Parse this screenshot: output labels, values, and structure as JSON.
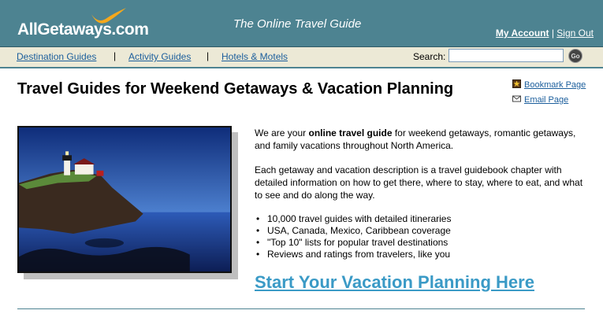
{
  "header": {
    "logo": "AllGetaways.com",
    "tagline": "The Online Travel Guide",
    "my_account": "My Account",
    "separator": "|",
    "sign_out": "Sign Out",
    "bg_color": "#4d8391"
  },
  "nav": {
    "items": [
      "Destination Guides",
      "Activity Guides",
      "Hotels & Motels"
    ],
    "separator": "|",
    "search_label": "Search:",
    "search_value": "",
    "go_label": "Go"
  },
  "main": {
    "title": "Travel Guides for Weekend Getaways & Vacation Planning",
    "side_links": {
      "bookmark": "Bookmark Page",
      "email": "Email Page"
    },
    "intro_before": "We are your ",
    "intro_bold": "online travel guide",
    "intro_after": " for weekend getaways, romantic getaways, and family vacations throughout North America.",
    "description": "Each getaway and vacation description is a travel guidebook chapter with detailed information on how to get there, where to stay, where to eat, and what to see and do along the way.",
    "features": [
      "10,000 travel guides with detailed itineraries",
      "USA, Canada, Mexico, Caribbean coverage",
      "\"Top 10\" lists for popular travel destinations",
      "Reviews and ratings from travelers, like you"
    ],
    "cta": "Start Your Vacation Planning Here",
    "link_color": "#1b5e9c",
    "cta_color": "#3a9ac6"
  }
}
